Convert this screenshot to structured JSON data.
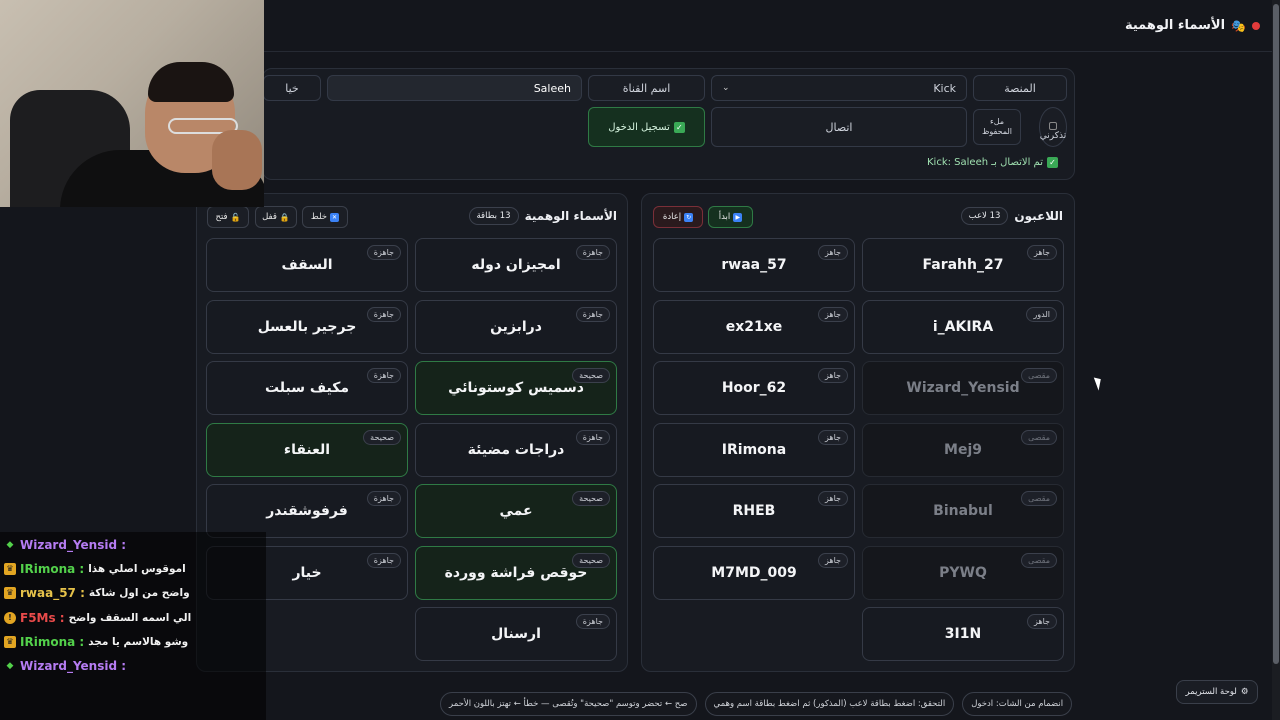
{
  "app": {
    "title": "الأسماء الوهمية",
    "title_icon": "masks-icon"
  },
  "connection": {
    "platform_label": "المنصة",
    "platform_value": "Kick",
    "channel_label": "اسم القناة",
    "channel_value": "Saleeh",
    "options_label": "خيا",
    "remember_label": "تذكرني",
    "saved_label": "ملء المحفوظ",
    "connect_label": "اتصال",
    "login_label": "تسجيل الدخول",
    "status": "تم الاتصال بـ Kick: Saleeh"
  },
  "names_section": {
    "title": "الأسماء الوهمية",
    "count": "13 بطاقة",
    "shuffle_label": "خلط",
    "lock_label": "قفل",
    "unlock_label": "فتح",
    "cards": [
      {
        "name": "امجيزان دوله",
        "status": "جاهزة",
        "state": "ready"
      },
      {
        "name": "السقف",
        "status": "جاهزة",
        "state": "ready"
      },
      {
        "name": "درابزين",
        "status": "جاهزة",
        "state": "ready"
      },
      {
        "name": "جرجير بالعسل",
        "status": "جاهزة",
        "state": "ready"
      },
      {
        "name": "دسميس كوستونائي",
        "status": "صحيحة",
        "state": "correct"
      },
      {
        "name": "مكيف سبلت",
        "status": "جاهزة",
        "state": "ready"
      },
      {
        "name": "دراجات مضيئة",
        "status": "جاهزة",
        "state": "ready"
      },
      {
        "name": "العنقاء",
        "status": "صحيحة",
        "state": "correct"
      },
      {
        "name": "عمي",
        "status": "صحيحة",
        "state": "correct"
      },
      {
        "name": "فرفوشقندر",
        "status": "جاهزة",
        "state": "ready"
      },
      {
        "name": "حوقص فراشة ووردة",
        "status": "صحيحة",
        "state": "correct"
      },
      {
        "name": "خيار",
        "status": "جاهزة",
        "state": "ready"
      },
      {
        "name": "ارسنال",
        "status": "جاهزة",
        "state": "ready"
      }
    ]
  },
  "players_section": {
    "title": "اللاعبون",
    "count": "13 لاعب",
    "start_label": "ابدأ",
    "reset_label": "إعادة",
    "players": [
      {
        "name": "Farahh_27",
        "status": "جاهز",
        "state": "ready"
      },
      {
        "name": "rwaa_57",
        "status": "جاهز",
        "state": "ready"
      },
      {
        "name": "i_AKIRA",
        "status": "الدور",
        "state": "turn"
      },
      {
        "name": "ex21xe",
        "status": "جاهز",
        "state": "ready"
      },
      {
        "name": "Wizard_Yensid",
        "status": "مقصى",
        "state": "out"
      },
      {
        "name": "Hoor_62",
        "status": "جاهز",
        "state": "ready"
      },
      {
        "name": "Mej9",
        "status": "مقصى",
        "state": "out"
      },
      {
        "name": "IRimona",
        "status": "جاهز",
        "state": "ready"
      },
      {
        "name": "Binabul",
        "status": "مقصى",
        "state": "out"
      },
      {
        "name": "RHEB",
        "status": "جاهز",
        "state": "ready"
      },
      {
        "name": "PYWQ",
        "status": "مقصى",
        "state": "out"
      },
      {
        "name": "M7MD_009",
        "status": "جاهز",
        "state": "ready"
      },
      {
        "name": "3I1N",
        "status": "جاهز",
        "state": "ready"
      }
    ]
  },
  "hints": {
    "join": "انضمام من الشات: ادخول",
    "verify": "التحقق: اضغط بطاقة لاعب (المذكور) ثم اضغط بطاقة اسم وهمي",
    "rules": "صح ← تحضر وتوسم \"صحيحة\" وتُقصى — خطأ ← تهتز باللون الأحمر"
  },
  "stream_panel_label": "لوحة الستريمر",
  "chat": [
    {
      "user": "Wizard_Yensid",
      "text": "",
      "badge": "diamond",
      "color": "#b57cf2"
    },
    {
      "user": "IRimona",
      "text": "اموقوس اصلي هذا",
      "badge": "crown",
      "color": "#53d14b"
    },
    {
      "user": "rwaa_57",
      "text": "واضح من اول شاكة",
      "badge": "crown",
      "color": "#e6c24a"
    },
    {
      "user": "F5Ms",
      "text": "الي اسمه السقف واضح",
      "badge": "warn",
      "color": "#e84a4a"
    },
    {
      "user": "IRimona",
      "text": "وشو هالاسم يا مجد",
      "badge": "crown",
      "color": "#53d14b"
    },
    {
      "user": "Wizard_Yensid",
      "text": "",
      "badge": "diamond",
      "color": "#b57cf2"
    }
  ]
}
